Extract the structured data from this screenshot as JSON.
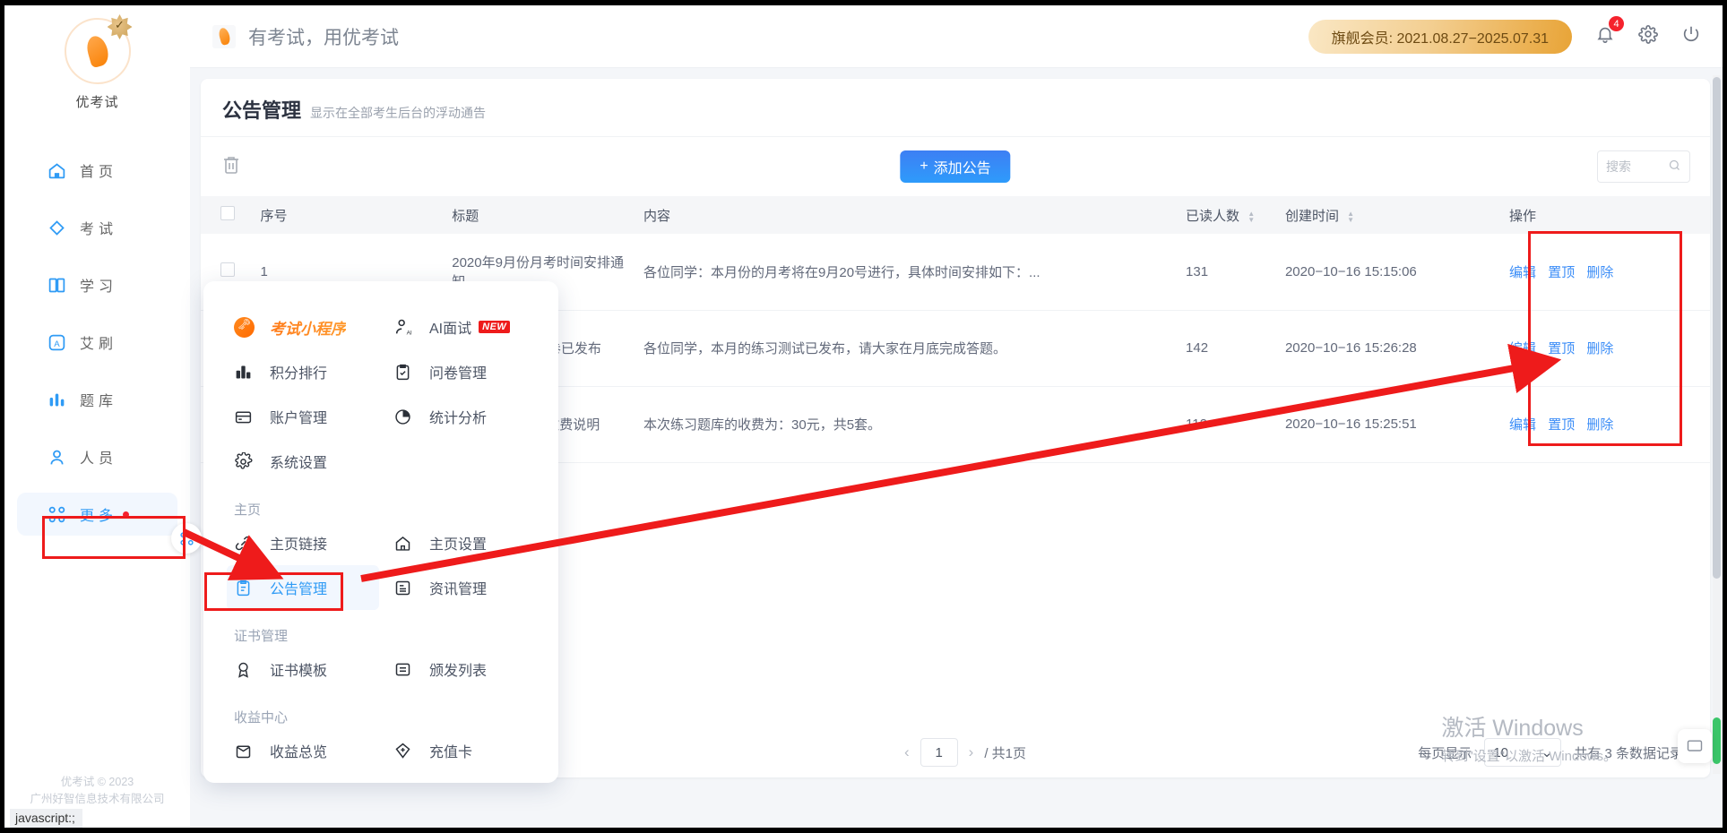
{
  "sidebar": {
    "brand_name": "优考试",
    "items": [
      {
        "label": "首页",
        "icon": "home-icon"
      },
      {
        "label": "考试",
        "icon": "diamond-icon"
      },
      {
        "label": "学习",
        "icon": "book-icon"
      },
      {
        "label": "艾刷",
        "icon": "a-square-icon"
      },
      {
        "label": "题库",
        "icon": "bars-icon"
      },
      {
        "label": "人员",
        "icon": "user-icon"
      },
      {
        "label": "更多",
        "icon": "grid-dots-icon"
      }
    ],
    "footer_line1": "优考试 © 2023",
    "footer_line2": "广州好智信息技术有限公司"
  },
  "status_bar": {
    "url": "javascript:;"
  },
  "topbar": {
    "title": "有考试，用优考试",
    "vip_badge": "旗舰会员: 2021.08.27−2025.07.31",
    "notification_count": "4",
    "icons": [
      "bell-icon",
      "gear-icon",
      "power-icon"
    ]
  },
  "page": {
    "title": "公告管理",
    "subtitle": "显示在全部考生后台的浮动通告"
  },
  "toolbar": {
    "delete_icon": "trash-icon",
    "add_label": "添加公告",
    "add_plus": "+",
    "search_placeholder": "搜索",
    "search_icon": "search-icon"
  },
  "table": {
    "columns": [
      "序号",
      "标题",
      "内容",
      "已读人数",
      "创建时间",
      "操作"
    ],
    "rows": [
      {
        "index": "1",
        "title": "2020年9月份月考时间安排通知",
        "content": "各位同学：本月份的月考将在9月20号进行，具体时间安排如下：...",
        "read_count": "131",
        "created_at": "2020−10−16 15:15:06"
      },
      {
        "index": "2",
        "title": "10月份练习测试卷已发布",
        "content": "各位同学，本月的练习测试已发布，请大家在月底完成答题。",
        "read_count": "142",
        "created_at": "2020−10−16 15:26:28"
      },
      {
        "index": "3",
        "title": "关于练习题库的收费说明",
        "content": "本次练习题库的收费为：30元，共5套。",
        "read_count": "112",
        "created_at": "2020−10−16 15:25:51"
      }
    ],
    "actions": [
      "编辑",
      "置顶",
      "删除"
    ]
  },
  "pagination": {
    "prev": "‹",
    "next": "›",
    "current_page": "1",
    "total_pages_label": "/ 共1页",
    "page_size_label": "每页显示",
    "page_size_value": "10",
    "chevron": "⌄",
    "total_label": "共有 3 条数据记录"
  },
  "mega_menu": {
    "top_items": [
      {
        "label": "考试小程序",
        "icon": "mini-program-icon",
        "brand": true
      },
      {
        "label": "AI面试",
        "icon": "ai-person-icon",
        "tag": "NEW"
      },
      {
        "label": "积分排行",
        "icon": "bar-chart-icon"
      },
      {
        "label": "问卷管理",
        "icon": "clipboard-check-icon"
      },
      {
        "label": "账户管理",
        "icon": "card-icon"
      },
      {
        "label": "统计分析",
        "icon": "pie-chart-icon"
      },
      {
        "label": "系统设置",
        "icon": "gear-icon"
      }
    ],
    "groups": [
      {
        "title": "主页",
        "items": [
          {
            "label": "主页链接",
            "icon": "link-icon"
          },
          {
            "label": "主页设置",
            "icon": "house-icon"
          },
          {
            "label": "公告管理",
            "icon": "announcement-icon",
            "selected": true
          },
          {
            "label": "资讯管理",
            "icon": "news-icon"
          }
        ]
      },
      {
        "title": "证书管理",
        "items": [
          {
            "label": "证书模板",
            "icon": "medal-icon"
          },
          {
            "label": "颁发列表",
            "icon": "list-doc-icon"
          }
        ]
      },
      {
        "title": "收益中心",
        "items": [
          {
            "label": "收益总览",
            "icon": "wallet-icon"
          },
          {
            "label": "充值卡",
            "icon": "diamond-plus-icon"
          }
        ]
      }
    ]
  },
  "watermark": {
    "line1": "激活 Windows",
    "line2": "转到\"设置\"以激活 Windows。"
  },
  "colors": {
    "accent_blue": "#2f9bf5",
    "annotation_red": "#ee1b1b",
    "vip_gold": "#e8a437",
    "badge_red": "#f5222d"
  }
}
